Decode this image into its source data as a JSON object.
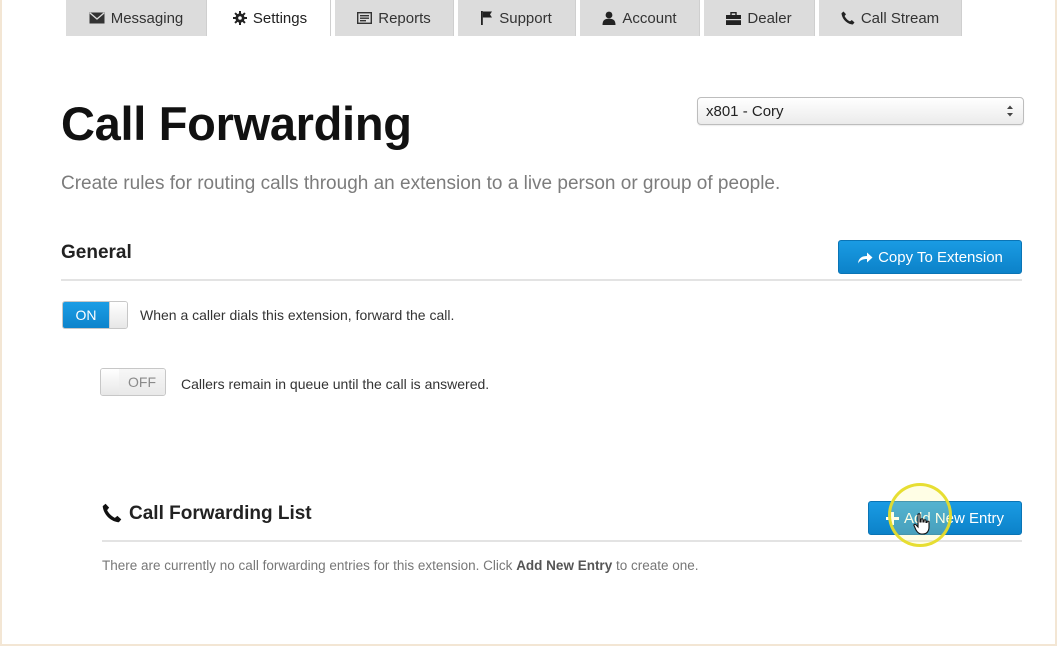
{
  "nav": {
    "tabs": [
      {
        "label": "Messaging",
        "icon": "envelope-icon",
        "active": false
      },
      {
        "label": "Settings",
        "icon": "gear-icon",
        "active": true
      },
      {
        "label": "Reports",
        "icon": "reports-icon",
        "active": false
      },
      {
        "label": "Support",
        "icon": "flag-icon",
        "active": false
      },
      {
        "label": "Account",
        "icon": "user-icon",
        "active": false
      },
      {
        "label": "Dealer",
        "icon": "briefcase-icon",
        "active": false
      },
      {
        "label": "Call Stream",
        "icon": "phone-icon",
        "active": false
      }
    ]
  },
  "page": {
    "title": "Call Forwarding",
    "description": "Create rules for routing calls through an extension to a live person or group of people.",
    "extension_select": {
      "value": "x801 - Cory"
    }
  },
  "general": {
    "title": "General",
    "copy_button": "Copy To Extension",
    "forward_toggle": {
      "state": "ON",
      "label": "When a caller dials this extension, forward the call."
    },
    "queue_toggle": {
      "state": "OFF",
      "label": "Callers remain in queue until the call is answered."
    }
  },
  "forwarding_list": {
    "title": "Call Forwarding List",
    "add_button": "Add New Entry",
    "empty_prefix": "There are currently no call forwarding entries for this extension. Click ",
    "empty_bold": "Add New Entry",
    "empty_suffix": " to create one."
  },
  "colors": {
    "accent": "#0c82c9",
    "tab_inactive": "#dcdcdc",
    "cursor_highlight": "#e6dc28"
  }
}
